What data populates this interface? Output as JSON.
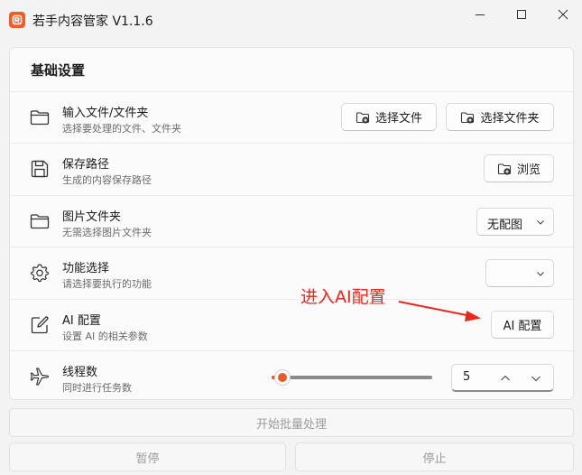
{
  "window": {
    "title": "若手内容管家 V1.1.6",
    "logo_letter": "R",
    "controls": [
      "minimize",
      "maximize",
      "close"
    ]
  },
  "card": {
    "title": "基础设置",
    "rows": [
      {
        "title": "输入文件/文件夹",
        "subtitle": "选择要处理的文件、文件夹",
        "icon": "folder-icon",
        "buttons": [
          "选择文件",
          "选择文件夹"
        ]
      },
      {
        "title": "保存路径",
        "subtitle": "生成的内容保存路径",
        "icon": "save-icon",
        "buttons": [
          "浏览"
        ]
      },
      {
        "title": "图片文件夹",
        "subtitle": "无需选择图片文件夹",
        "icon": "folder-icon",
        "dropdown_value": "无配图"
      },
      {
        "title": "功能选择",
        "subtitle": "请选择要执行的功能",
        "icon": "gear-icon",
        "dropdown_value": ""
      },
      {
        "title": "AI 配置",
        "subtitle": "设置 AI 的相关参数",
        "icon": "edit-icon",
        "buttons": [
          "AI 配置"
        ]
      },
      {
        "title": "线程数",
        "subtitle": "同时进行任务数",
        "icon": "airplane-icon",
        "slider_fraction": 0.07,
        "number_value": "5"
      }
    ]
  },
  "annotation": {
    "text": "进入AI配置",
    "color": "#e8281e"
  },
  "actions": {
    "start": "开始批量处理",
    "pause": "暂停",
    "stop": "停止"
  },
  "colors": {
    "accent": "#e85a2a",
    "logo": "#f25c26"
  }
}
